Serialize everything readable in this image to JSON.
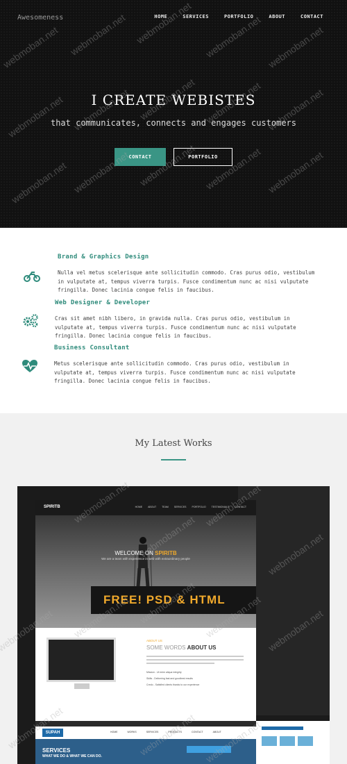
{
  "header": {
    "brand": "Awesomeness",
    "nav": [
      "HOME",
      "SERVICES",
      "PORTFOLIO",
      "ABOUT",
      "CONTACT"
    ]
  },
  "hero": {
    "title": "I CREATE WEBISTES",
    "subtitle": "that communicates, connects and engages customers",
    "contact_button": "CONTACT",
    "portfolio_button": "PORTFOLIO"
  },
  "services": [
    {
      "icon": "motorcycle-icon",
      "title": "Brand & Graphics Design",
      "text": "Nulla vel metus scelerisque ante sollicitudin commodo. Cras purus odio, vestibulum in vulputate at, tempus viverra turpis. Fusce condimentum nunc ac nisi vulputate fringilla. Donec lacinia congue felis in faucibus."
    },
    {
      "icon": "gears-icon",
      "title": "Web Designer & Developer",
      "text": "Cras sit amet nibh libero, in gravida nulla. Cras purus odio, vestibulum in vulputate at, tempus viverra turpis. Fusce condimentum nunc ac nisi vulputate fringilla. Donec lacinia congue felis in faucibus."
    },
    {
      "icon": "heart-pulse-icon",
      "title": "Business Consultant",
      "text": "Metus scelerisque ante sollicitudin commodo. Cras purus odio, vestibulum in vulputate at, tempus viverra turpis. Fusce condimentum nunc ac nisi vulputate fringilla. Donec lacinia congue felis in faucibus."
    }
  ],
  "works": {
    "title": "My Latest Works",
    "preview": {
      "logo": "SPIRITB",
      "menu": [
        "HOME",
        "ABOUT",
        "TEAM",
        "SERVICES",
        "PORTFOLIO",
        "TESTIMONIALS",
        "CONTACT"
      ],
      "welcome_text": "WELCOME ON ",
      "welcome_brand": "SPIRITB",
      "tagline": "We are a team with experience in web with extraordinary people",
      "banner": "FREE!  PSD & HTML",
      "about_label": "ABOUT US",
      "about_heading_light": "SOME WORDS ",
      "about_heading_bold": "ABOUT US",
      "about_list": [
        "Mission - Ut enim aliqua integrity",
        "Skills - Delivering fast and goodbest results",
        "Credo - Satisfied clients thanks to our experience"
      ],
      "second_logo": "SUPAH",
      "second_menu": [
        "HOME",
        "WORKS",
        "SERVICES",
        "PRODUCTS",
        "CONTACT",
        "ABOUT"
      ],
      "second_services": "SERVICES",
      "second_services_sub": "WHAT WE DO & WHAT WE CAN DO."
    }
  },
  "watermark": "webmoban.net",
  "colors": {
    "accent": "#3a9585",
    "hero_bg": "#111111",
    "works_bg": "#f1f1f1",
    "highlight": "#f0a92c"
  }
}
